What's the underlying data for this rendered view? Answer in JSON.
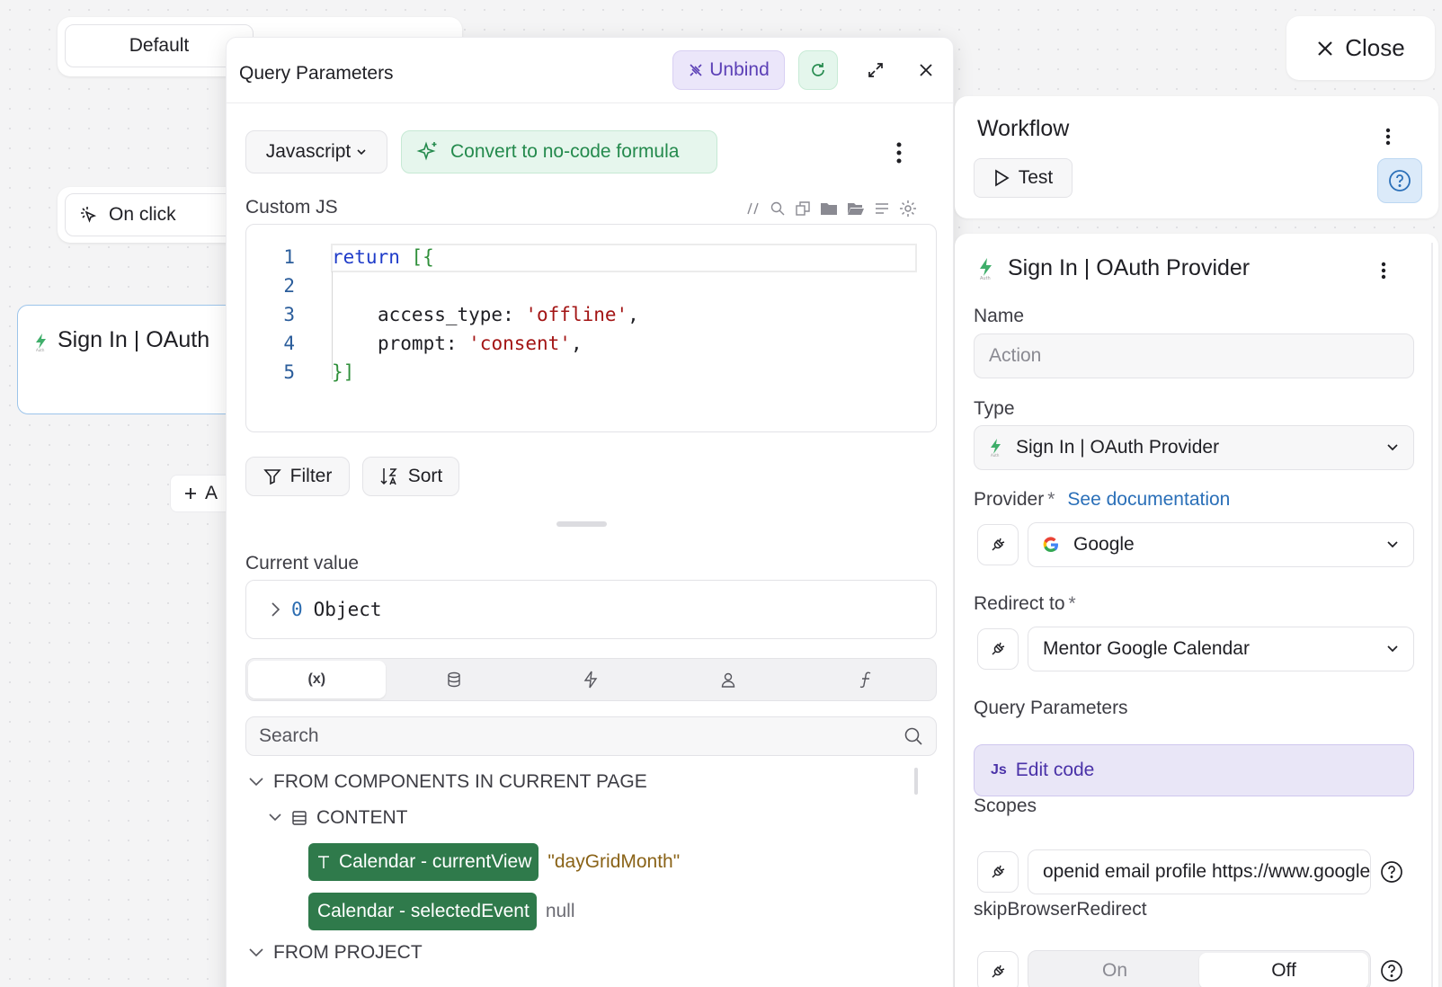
{
  "canvas": {
    "variant_label": "Default",
    "trigger_label": "On click",
    "action_node_label": "Sign In | OAuth",
    "add_action_label": "A"
  },
  "query_modal": {
    "title": "Query Parameters",
    "unbind_label": "Unbind",
    "language": "Javascript",
    "convert_label": "Convert to no-code formula",
    "custom_js_label": "Custom JS",
    "code": {
      "line_numbers": [
        "1",
        "2",
        "3",
        "4",
        "5"
      ],
      "line1_kw": "return",
      "line1_br": " [{",
      "line3_key": "access_type: ",
      "line3_val": "'offline'",
      "line3_tail": ",",
      "line4_key": "prompt: ",
      "line4_val": "'consent'",
      "line4_tail": ",",
      "line5": "}]"
    },
    "filter_label": "Filter",
    "sort_label": "Sort",
    "current_value_label": "Current value",
    "current_value_index": "0",
    "current_value_type": "Object",
    "picker_tabs": [
      "(x)",
      "database-icon",
      "bolt-icon",
      "user-icon",
      "function-icon"
    ],
    "search_placeholder": "Search",
    "tree": {
      "group_components": "FROM COMPONENTS IN CURRENT PAGE",
      "group_content": "CONTENT",
      "var1_name": "Calendar - currentView",
      "var1_value": "\"dayGridMonth\"",
      "var2_name": "Calendar - selectedEvent",
      "var2_value": "null",
      "group_project": "FROM PROJECT"
    }
  },
  "close_label": "Close",
  "workflow": {
    "title": "Workflow",
    "test_label": "Test"
  },
  "action_panel": {
    "title": "Sign In | OAuth Provider",
    "name_label": "Name",
    "name_placeholder": "Action",
    "type_label": "Type",
    "type_value": "Sign In | OAuth Provider",
    "provider_label": "Provider",
    "required_mark": "*",
    "provider_doc_link": "See documentation",
    "provider_value": "Google",
    "redirect_label": "Redirect to",
    "redirect_value": "Mentor Google Calendar",
    "query_params_label": "Query Parameters",
    "edit_code_prefix": "Js",
    "edit_code_label": "Edit code",
    "scopes_label": "Scopes",
    "scopes_value": "openid email profile https://www.googleapis.com/auth/calendar",
    "skip_label": "skipBrowserRedirect",
    "skip_on": "On",
    "skip_off": "Off"
  },
  "colors": {
    "accent_green": "#2f7a4b",
    "accent_purple": "#5b3fb6",
    "link_blue": "#2a6fb8"
  }
}
